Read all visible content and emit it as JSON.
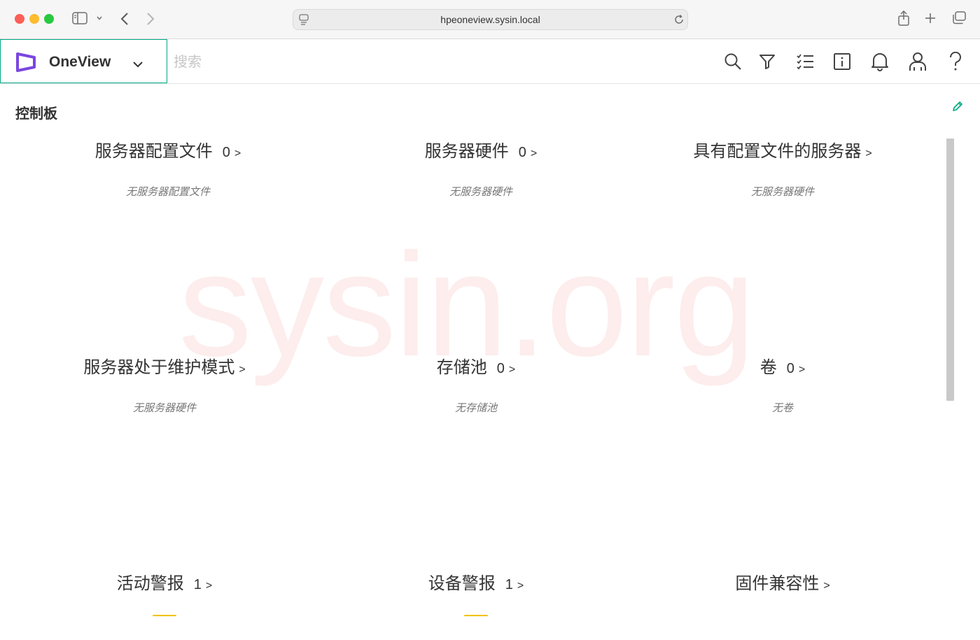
{
  "browser": {
    "url": "hpeoneview.sysin.local"
  },
  "app": {
    "name": "OneView",
    "search_placeholder": "搜索",
    "accent_color": "#01a982",
    "logo_color": "#7b46e0"
  },
  "header_icons": [
    "search-icon",
    "filter-icon",
    "activity-list-icon",
    "info-icon",
    "notification-bell-icon",
    "user-icon",
    "help-icon"
  ],
  "dashboard": {
    "title": "控制板",
    "watermark": "sysin.org",
    "panels": [
      {
        "title": "服务器配置文件",
        "count": "0",
        "arrow": ">",
        "empty": "无服务器配置文件"
      },
      {
        "title": "服务器硬件",
        "count": "0",
        "arrow": ">",
        "empty": "无服务器硬件"
      },
      {
        "title": "具有配置文件的服务器",
        "count": "",
        "arrow": ">",
        "empty": "无服务器硬件"
      },
      {
        "title": "服务器处于维护模式",
        "count": "",
        "arrow": ">",
        "empty": "无服务器硬件"
      },
      {
        "title": "存储池",
        "count": "0",
        "arrow": ">",
        "empty": "无存储池"
      },
      {
        "title": "卷",
        "count": "0",
        "arrow": ">",
        "empty": "无卷"
      },
      {
        "title": "活动警报",
        "count": "1",
        "arrow": ">",
        "empty": ""
      },
      {
        "title": "设备警报",
        "count": "1",
        "arrow": ">",
        "empty": ""
      },
      {
        "title": "固件兼容性",
        "count": "",
        "arrow": ">",
        "empty": ""
      }
    ]
  }
}
